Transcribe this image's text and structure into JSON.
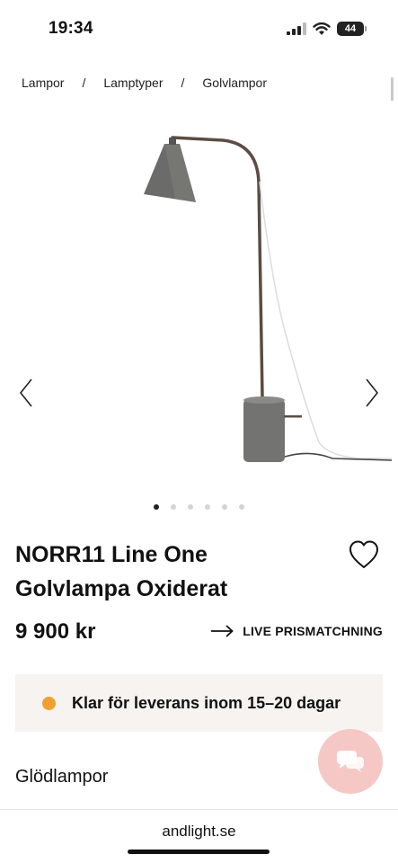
{
  "status_bar": {
    "time": "19:34",
    "battery": "44"
  },
  "breadcrumb": [
    "Lampor",
    "Lamptyper",
    "Golvlampor"
  ],
  "gallery": {
    "image_count": 6,
    "active_index": 0,
    "image_alt": "NORR11 Line One Golvlampa Oxiderat"
  },
  "product": {
    "title_line1": "NORR11 Line One",
    "title_line2": "Golvlampa Oxiderat",
    "price": "9 900 kr",
    "price_match_label": "LIVE PRISMATCHNING"
  },
  "delivery": {
    "text": "Klar för leverans inom 15–20 dagar",
    "status_color": "#f0a030"
  },
  "section": {
    "title": "Glödlampor"
  },
  "browser": {
    "url": "andlight.se"
  },
  "colors": {
    "chat_button": "#f5c7c5",
    "delivery_bg": "#f6f3f0"
  }
}
